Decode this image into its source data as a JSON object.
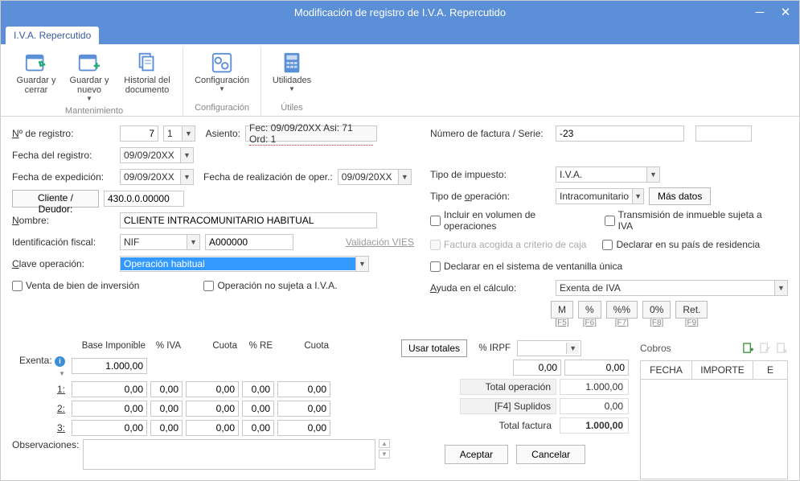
{
  "window": {
    "title": "Modificación de registro de I.V.A. Repercutido"
  },
  "tab": {
    "main": "I.V.A. Repercutido"
  },
  "ribbon": {
    "groups": {
      "mantenimiento": {
        "label": "Mantenimiento",
        "save_close": "Guardar y cerrar",
        "save_new": "Guardar y nuevo",
        "history": "Historial del documento"
      },
      "configuracion": {
        "label": "Configuración",
        "config_btn": "Configuración"
      },
      "utiles": {
        "label": "Útiles",
        "util_btn": "Utilidades"
      }
    }
  },
  "form": {
    "n_registro_lbl": "Nº de registro:",
    "n_registro_val": "7",
    "n_registro_sub": "1",
    "asiento_lbl": "Asiento:",
    "asiento_val": "Fec: 09/09/20XX Asi: 71 Ord: 1",
    "fecha_registro_lbl": "Fecha del registro:",
    "fecha_registro_val": "09/09/20XX",
    "fecha_exped_lbl": "Fecha de expedición:",
    "fecha_exped_val": "09/09/20XX",
    "fecha_realiz_lbl": "Fecha de realización de oper.:",
    "fecha_realiz_val": "09/09/20XX",
    "cliente_btn": "Cliente / Deudor:",
    "cliente_val": "430.0.0.00000",
    "nombre_lbl": "Nombre:",
    "nombre_val": "CLIENTE INTRACOMUNITARIO HABITUAL",
    "idfiscal_lbl": "Identificación fiscal:",
    "idfiscal_tipo": "NIF",
    "idfiscal_num": "A000000",
    "vies_link": "Validación VIES",
    "clave_lbl": "Clave operación:",
    "clave_val": "Operación habitual",
    "chk_venta_bien": "Venta de bien de inversión",
    "chk_op_no_sujeta": "Operación no sujeta a I.V.A.",
    "num_factura_lbl": "Número de factura / Serie:",
    "num_factura_val": "-23",
    "tipo_impuesto_lbl": "Tipo de impuesto:",
    "tipo_impuesto_val": "I.V.A.",
    "tipo_operacion_lbl": "Tipo de operación:",
    "tipo_operacion_val": "Intracomunitario",
    "mas_datos_btn": "Más datos",
    "chk_incluir_vol": "Incluir en volumen de operaciones",
    "chk_transm_inm": "Transmisión de inmueble sujeta a IVA",
    "chk_criterio_caja": "Factura acogida a criterio de caja",
    "chk_declarar_pais": "Declarar en su país de residencia",
    "chk_ventanilla": "Declarar en el sistema de ventanilla única",
    "ayuda_calc_lbl": "Ayuda en el cálculo:",
    "ayuda_calc_val": "Exenta de IVA",
    "buttons": {
      "m": "M",
      "pct": "%",
      "pctpct": "%%",
      "zero": "0%",
      "ret": "Ret."
    },
    "shortcuts": {
      "m": "[F5]",
      "pct": "[F6]",
      "pctpct": "[F7]",
      "zero": "[F8]",
      "ret": "[F9]"
    }
  },
  "grid": {
    "headers": {
      "base": "Base Imponible",
      "iva": "% IVA",
      "cuota": "Cuota",
      "re": "% RE",
      "cuota2": "Cuota",
      "usar": "Usar totales",
      "irpf": "% IRPF"
    },
    "rows": {
      "exenta_lbl": "Exenta:",
      "exenta_base": "1.000,00",
      "irpf_val": "0,00",
      "irpf_amount": "0,00",
      "r1_lbl": "1:",
      "r2_lbl": "2:",
      "r3_lbl": "3:",
      "zero": "0,00"
    },
    "totals": {
      "op_lbl": "Total operación",
      "op_val": "1.000,00",
      "sup_lbl": "[F4] Suplidos",
      "sup_val": "0,00",
      "fac_lbl": "Total factura",
      "fac_val": "1.000,00"
    },
    "obs_lbl": "Observaciones:"
  },
  "cobros": {
    "title": "Cobros",
    "cols": {
      "fecha": "FECHA",
      "importe": "IMPORTE",
      "e": "E"
    }
  },
  "dialog": {
    "ok": "Aceptar",
    "cancel": "Cancelar"
  }
}
